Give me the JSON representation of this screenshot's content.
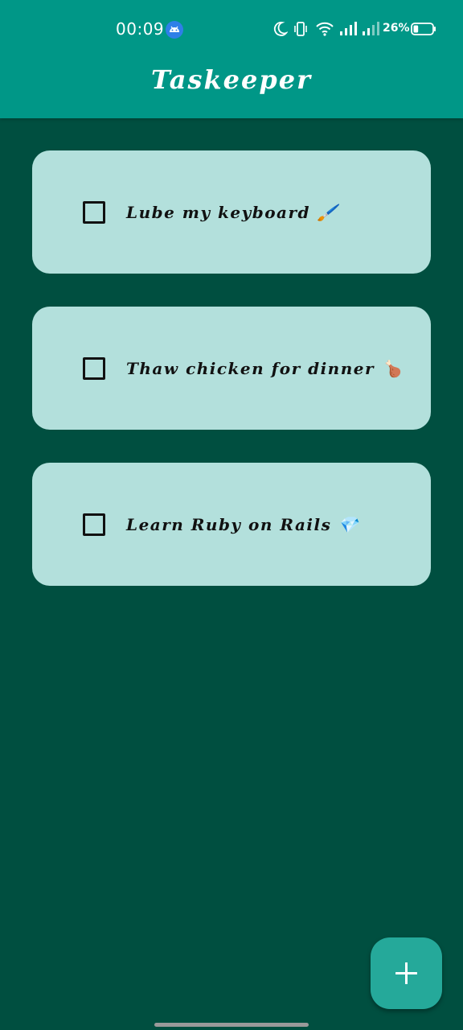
{
  "status_bar": {
    "time": "00:09",
    "battery_percent": "26%",
    "battery_level": 0.26,
    "icons": [
      "android-icon",
      "moon-icon",
      "vibrate-icon",
      "wifi-icon",
      "signal-icon",
      "signal-icon-2",
      "battery-icon"
    ]
  },
  "app": {
    "title": "Taskeeper"
  },
  "tasks": [
    {
      "label": "Lube my keyboard 🖌️",
      "checked": false
    },
    {
      "label": "Thaw chicken for dinner 🍗",
      "checked": false
    },
    {
      "label": "Learn Ruby on Rails 💎",
      "checked": false
    }
  ],
  "fab": {
    "icon": "plus-icon"
  },
  "colors": {
    "app_bar": "#009787",
    "background": "#004F40",
    "card": "#B3E0DC",
    "fab": "#25A99A"
  }
}
